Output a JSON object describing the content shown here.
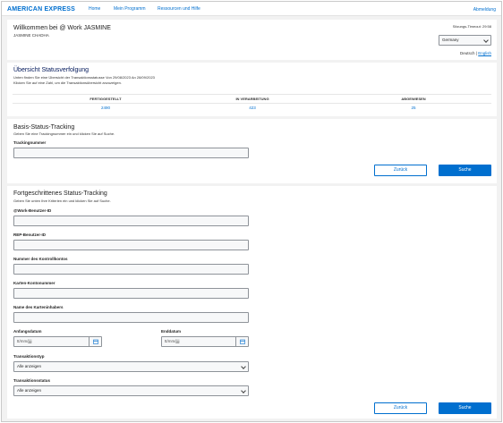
{
  "header": {
    "brand": "AMERICAN EXPRESS",
    "nav": [
      "Home",
      "Mein Programm",
      "Ressourcen und Hilfe"
    ],
    "signout": "Abmeldung"
  },
  "welcome": {
    "title": "Willkommen bei @ Work JASMINE",
    "user": "JASMINE CHADHA",
    "timeout": "Sitzungs-Timeout: 29:58",
    "country": "Germany",
    "lang_active": "Deutsch",
    "lang_sep": "|",
    "lang_other": "English"
  },
  "overview": {
    "title": "Übersicht Statusverfolgung",
    "desc1": "Unten finden Sie eine Übersicht der Transaktionsstatusse Von 29/08/2023 An 28/09/2023",
    "desc2": "Klicken Sie auf eine Zahl, um die Transaktionsübersicht anzuzeigen.",
    "columns": [
      {
        "label": "FERTIGGESTELLT",
        "value": "2490"
      },
      {
        "label": "IN VERARBEITUNG",
        "value": "423"
      },
      {
        "label": "ABGEWIESEN",
        "value": "25"
      }
    ]
  },
  "basic": {
    "title": "Basis-Status-Tracking",
    "desc": "Geben Sie eine Trackingnummer ein und klicken Sie auf Suche.",
    "field_label": "Trackingnummer",
    "field_value": "",
    "back": "Zurück",
    "search": "Suche"
  },
  "advanced": {
    "title": "Fortgeschrittenes Status-Tracking",
    "desc": "Geben Sie unten Ihre Kriterien ein und klicken Sie auf Suche.",
    "fields": [
      "@Work-Benutzer-ID",
      "REP-Benutzer-ID",
      "Nummer des Kontrollkontos",
      "Karten-Kontonummer",
      "Name des Karteninhabers"
    ],
    "start_label": "Anfangsdatum",
    "end_label": "Enddatum",
    "date_placeholder": "tt/mm/jjjj",
    "type_label": "Transaktionstyp",
    "type_value": "Alle anzeigen",
    "status_label": "Transaktionsstatus",
    "status_value": "Alle anzeigen",
    "back": "Zurück",
    "search": "Suche"
  },
  "colors": {
    "brand_blue": "#006fcf",
    "dark_blue": "#00175a",
    "background": "#f2f2f2"
  }
}
